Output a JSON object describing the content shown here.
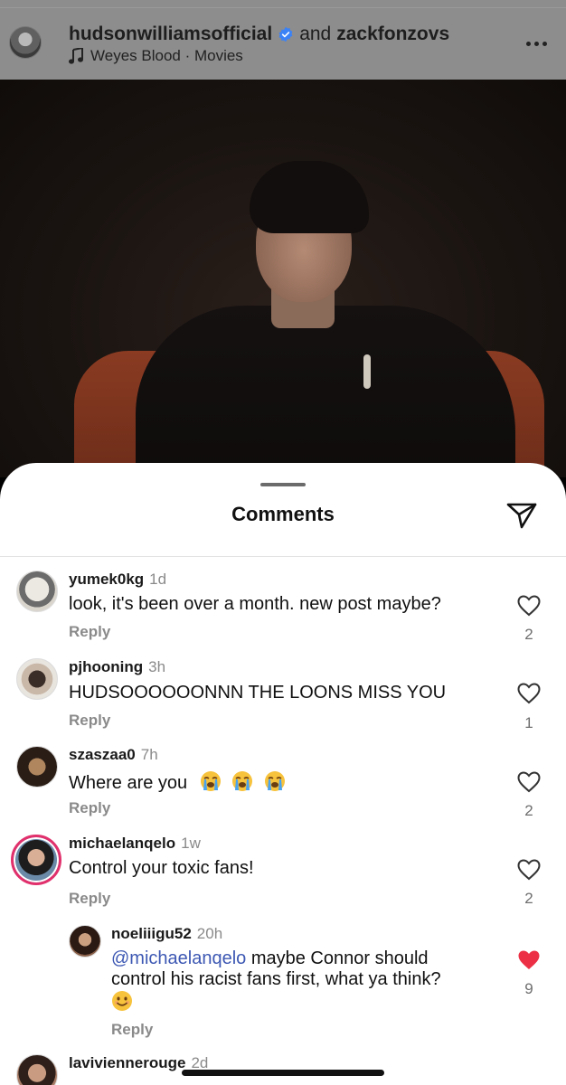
{
  "post": {
    "author": "hudsonwilliamsofficial",
    "conjunction": "and",
    "coauthor": "zackfonzovs",
    "music": "Weyes Blood · Movies",
    "verified_icon": "verified-badge-icon",
    "more_icon": "more-options-icon"
  },
  "sheet": {
    "title": "Comments",
    "share_icon": "send-icon"
  },
  "comments": [
    {
      "user": "yumek0kg",
      "time": "1d",
      "text": "look, it's been over a month. new post  maybe?",
      "reply": "Reply",
      "likes": "2",
      "liked": false
    },
    {
      "user": "pjhooning",
      "time": "3h",
      "text": "HUDSOOOOOONNN THE LOONS MISS YOU",
      "reply": "Reply",
      "likes": "1",
      "liked": false
    },
    {
      "user": "szaszaa0",
      "time": "7h",
      "text": "Where are you",
      "emojis": "loudly-crying-face x3",
      "reply": "Reply",
      "likes": "2",
      "liked": false
    },
    {
      "user": "michaelanqelo",
      "time": "1w",
      "text": "Control your toxic fans!",
      "reply": "Reply",
      "likes": "2",
      "liked": false
    },
    {
      "user": "noeliiigu52",
      "time": "20h",
      "mention": "@michaelanqelo",
      "text": " maybe Connor should control his racist fans first, what ya think?",
      "emojis": "smiling-face",
      "reply": "Reply",
      "likes": "9",
      "liked": true
    },
    {
      "user": "laviviennerouge",
      "time": "2d"
    }
  ],
  "colors": {
    "like_red": "#ed2f45",
    "mention_blue": "#3d58b3",
    "story_ring": "#e1306c"
  }
}
